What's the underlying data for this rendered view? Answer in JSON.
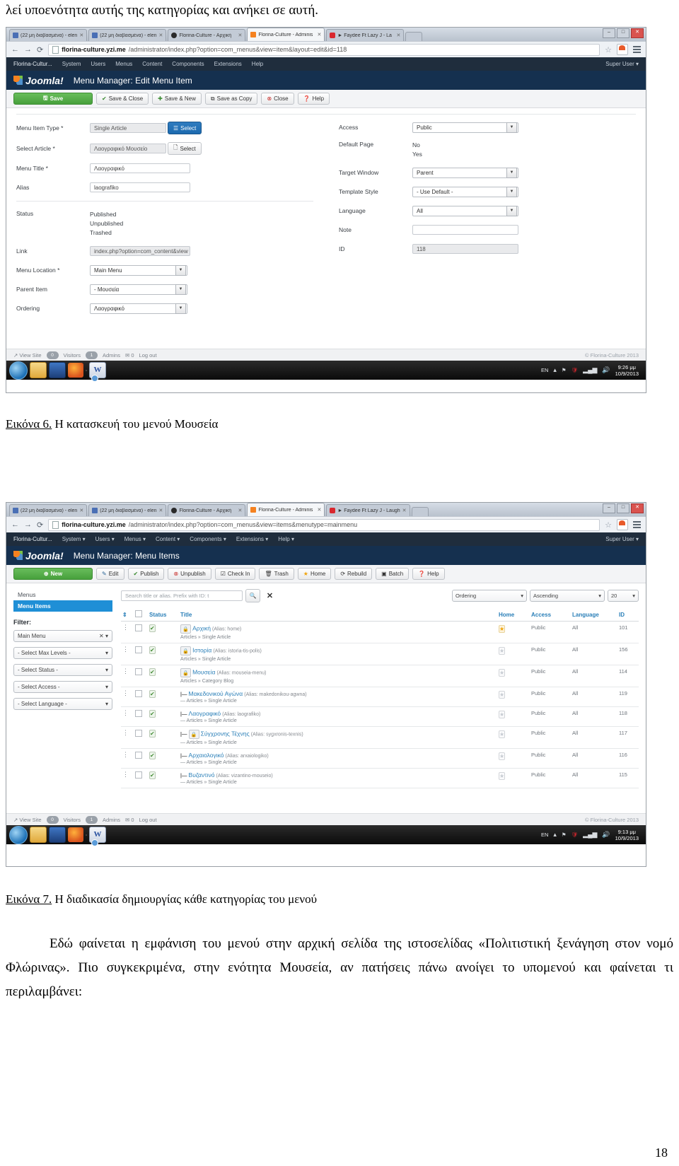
{
  "document": {
    "top_text": "λεί υποενότητα αυτής της κατηγορίας και ανήκει σε αυτή.",
    "caption6_lead": "Εικόνα 6.",
    "caption6_text": " Η κατασκευή του μενού Μουσεία",
    "caption7_lead": "Εικόνα 7.",
    "caption7_text": " Η διαδικασία δημιουργίας κάθε κατηγορίας του μενού",
    "para1": "Εδώ φαίνεται η εμφάνιση του μενού στην αρχική σελίδα της ιστοσελίδας «Πολιτιστική ξενάγηση στον νομό Φλώρινας». Πιο συγκεκριμένα, στην ενότητα Μουσεία, αν πατήσεις πάνω ανοίγει το υπομενού και φαίνεται τι περιλαμβάνει:",
    "page_number": "18"
  },
  "shot1": {
    "tabs": [
      {
        "label": "(22 μη διαβασμένα) - elen",
        "icon": "mail-icon",
        "active": false
      },
      {
        "label": "(22 μη διαβασμένα) - elen",
        "icon": "mail-icon",
        "active": false
      },
      {
        "label": "Florina-Culture - Αρχική",
        "icon": "globe-icon",
        "active": false
      },
      {
        "label": "Florina-Culture - Adminis",
        "icon": "joomla-icon",
        "active": true
      },
      {
        "label": "► Faydee Ft Lazy J - La",
        "icon": "youtube-icon",
        "active": false
      }
    ],
    "window_buttons": [
      "–",
      "□",
      "✕"
    ],
    "url": "florina-culture.yzi.me/administrator/index.php?option=com_menus&view=item&layout=edit&id=118",
    "url_host": "florina-culture.yzi.me",
    "url_path": "/administrator/index.php?option=com_menus&view=item&layout=edit&id=118",
    "adminbar": {
      "site": "Florina-Cultur...",
      "menus": [
        "System",
        "Users",
        "Menus",
        "Content",
        "Components",
        "Extensions",
        "Help"
      ],
      "user": "Super User"
    },
    "brand": "Joomla!",
    "page_title": "Menu Manager: Edit Menu Item",
    "toolbar": [
      {
        "label": "Save",
        "icon": "save-icon",
        "style": "primary"
      },
      {
        "label": "Save & Close",
        "icon": "check-icon",
        "style": "default"
      },
      {
        "label": "Save & New",
        "icon": "plus-icon",
        "style": "default"
      },
      {
        "label": "Save as Copy",
        "icon": "copy-icon",
        "style": "default"
      },
      {
        "label": "Close",
        "icon": "close-icon",
        "style": "default"
      },
      {
        "label": "Help",
        "icon": "help-icon",
        "style": "default"
      }
    ],
    "form_left": {
      "menu_item_type_label": "Menu Item Type *",
      "menu_item_type_value": "Single Article",
      "menu_item_type_button": "Select",
      "select_article_label": "Select Article *",
      "select_article_value": "Λαογραφικό Μουσείο",
      "select_article_button": "Select",
      "menu_title_label": "Menu Title *",
      "menu_title_value": "Λαογραφικό",
      "alias_label": "Alias",
      "alias_value": "laografiko",
      "status_label": "Status",
      "status_options": [
        "Published",
        "Unpublished",
        "Trashed"
      ],
      "link_label": "Link",
      "link_value": "index.php?option=com_content&view",
      "menu_location_label": "Menu Location *",
      "menu_location_value": "Main Menu",
      "parent_item_label": "Parent Item",
      "parent_item_value": "- Μουσεία",
      "ordering_label": "Ordering",
      "ordering_value": "Λαογραφικό"
    },
    "form_right": {
      "access_label": "Access",
      "access_value": "Public",
      "default_page_label": "Default Page",
      "default_page_options": [
        "No",
        "Yes"
      ],
      "target_window_label": "Target Window",
      "target_window_value": "Parent",
      "template_style_label": "Template Style",
      "template_style_value": "- Use Default -",
      "language_label": "Language",
      "language_value": "All",
      "note_label": "Note",
      "note_value": "",
      "id_label": "ID",
      "id_value": "118"
    },
    "status_strip": {
      "view_site": "View Site",
      "visitors_count": "0",
      "visitors_label": "Visitors",
      "admins_count": "1",
      "admins_label": "Admins",
      "messages_count": "0",
      "logout": "Log out",
      "copyright": "© Florina-Culture 2013"
    },
    "taskbar": {
      "language": "EN",
      "time": "9:26 μμ",
      "date": "10/9/2013",
      "apps": [
        "start-orb",
        "explorer-icon",
        "media-player-icon",
        "firefox-icon",
        "chrome-icon",
        "word-icon"
      ]
    }
  },
  "shot2": {
    "tabs": [
      {
        "label": "(22 μη διαβασμένα) - elen",
        "icon": "mail-icon",
        "active": false
      },
      {
        "label": "(22 μη διαβασμένα) - elen",
        "icon": "mail-icon",
        "active": false
      },
      {
        "label": "Florina-Culture - Αρχική",
        "icon": "globe-icon",
        "active": false
      },
      {
        "label": "Florina-Culture - Adminis",
        "icon": "joomla-icon",
        "active": true
      },
      {
        "label": "► Faydee Ft Lazy J - Laugh",
        "icon": "youtube-icon",
        "active": false
      }
    ],
    "window_buttons": [
      "–",
      "□",
      "✕"
    ],
    "url_host": "florina-culture.yzi.me",
    "url_path": "/administrator/index.php?option=com_menus&view=items&menutype=mainmenu",
    "adminbar": {
      "site": "Florina-Cultur...",
      "menus": [
        "System",
        "Users",
        "Menus",
        "Content",
        "Components",
        "Extensions",
        "Help"
      ],
      "user": "Super User"
    },
    "brand": "Joomla!",
    "page_title": "Menu Manager: Menu Items",
    "toolbar": [
      {
        "label": "New",
        "icon": "plus-circle-icon",
        "style": "primary"
      },
      {
        "label": "Edit",
        "icon": "edit-icon",
        "style": "default"
      },
      {
        "label": "Publish",
        "icon": "check-icon",
        "style": "default"
      },
      {
        "label": "Unpublish",
        "icon": "close-circle-icon",
        "style": "default"
      },
      {
        "label": "Check In",
        "icon": "checkbox-icon",
        "style": "default"
      },
      {
        "label": "Trash",
        "icon": "trash-icon",
        "style": "default"
      },
      {
        "label": "Home",
        "icon": "star-icon",
        "style": "default"
      },
      {
        "label": "Rebuild",
        "icon": "refresh-icon",
        "style": "default"
      },
      {
        "label": "Batch",
        "icon": "batch-icon",
        "style": "default"
      },
      {
        "label": "Help",
        "icon": "help-icon",
        "style": "default"
      }
    ],
    "sidebar": {
      "menus_label": "Menus",
      "menu_items_label": "Menu Items",
      "filter_label": "Filter:",
      "filters": [
        {
          "value": "Main Menu",
          "clearable": true
        },
        {
          "value": "- Select Max Levels -",
          "clearable": false
        },
        {
          "value": "- Select Status -",
          "clearable": false
        },
        {
          "value": "- Select Access -",
          "clearable": false
        },
        {
          "value": "- Select Language -",
          "clearable": false
        }
      ]
    },
    "search": {
      "placeholder": "Search title or alias. Prefix with ID: t",
      "search_icon": "search-icon",
      "clear_icon": "clear-icon"
    },
    "sorting": {
      "order_by": "Ordering",
      "direction": "Ascending",
      "limit": "20"
    },
    "table": {
      "headers": [
        "",
        "",
        "Status",
        "Title",
        "Home",
        "Access",
        "Language",
        "ID"
      ],
      "rows": [
        {
          "title": "Αρχική",
          "alias": "(Alias: home)",
          "sub": "Articles » Single Article",
          "indent": 0,
          "locked": true,
          "home": true,
          "access": "Public",
          "language": "All",
          "id": "101"
        },
        {
          "title": "Ιστορία",
          "alias": "(Alias: istoria-tis-polis)",
          "sub": "Articles » Single Article",
          "indent": 0,
          "locked": true,
          "home": false,
          "access": "Public",
          "language": "All",
          "id": "156"
        },
        {
          "title": "Μουσεία",
          "alias": "(Alias: mouseia-menu)",
          "sub": "Articles » Category Blog",
          "indent": 0,
          "locked": true,
          "home": false,
          "access": "Public",
          "language": "All",
          "id": "114"
        },
        {
          "title": "Μακεδονικού Αγώνα",
          "alias": "(Alias: makedonikou-agwna)",
          "sub": "— Articles » Single Article",
          "indent": 1,
          "locked": false,
          "home": false,
          "access": "Public",
          "language": "All",
          "id": "119"
        },
        {
          "title": "Λαογραφικό",
          "alias": "(Alias: laografiko)",
          "sub": "— Articles » Single Article",
          "indent": 1,
          "locked": false,
          "home": false,
          "access": "Public",
          "language": "All",
          "id": "118"
        },
        {
          "title": "Σύγχρονης Τέχνης",
          "alias": "(Alias: sygxronis-texnis)",
          "sub": "— Articles » Single Article",
          "indent": 1,
          "locked": true,
          "home": false,
          "access": "Public",
          "language": "All",
          "id": "117"
        },
        {
          "title": "Αρχαιολογικό",
          "alias": "(Alias: arxaiologiko)",
          "sub": "— Articles » Single Article",
          "indent": 1,
          "locked": false,
          "home": false,
          "access": "Public",
          "language": "All",
          "id": "116"
        },
        {
          "title": "Βυζαντινό",
          "alias": "(Alias: vizantino-mouseio)",
          "sub": "— Articles » Single Article",
          "indent": 1,
          "locked": false,
          "home": false,
          "access": "Public",
          "language": "All",
          "id": "115"
        }
      ]
    },
    "status_strip": {
      "view_site": "View Site",
      "visitors_count": "0",
      "visitors_label": "Visitors",
      "admins_count": "1",
      "admins_label": "Admins",
      "messages_count": "0",
      "logout": "Log out",
      "copyright": "© Florina-Culture 2013"
    },
    "taskbar": {
      "language": "EN",
      "time": "9:13 μμ",
      "date": "10/9/2013",
      "apps": [
        "start-orb",
        "explorer-icon",
        "media-player-icon",
        "firefox-icon",
        "chrome-icon",
        "word-icon"
      ]
    }
  }
}
